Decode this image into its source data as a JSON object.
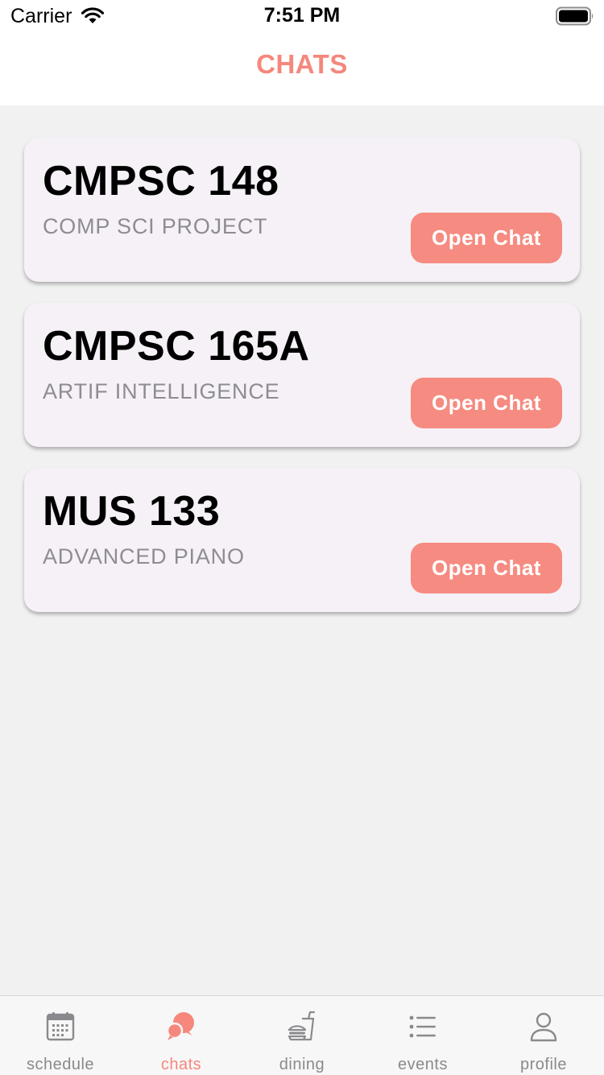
{
  "status_bar": {
    "carrier": "Carrier",
    "time": "7:51 PM"
  },
  "header": {
    "title": "CHATS"
  },
  "chats": [
    {
      "code": "CMPSC 148",
      "name": "COMP SCI PROJECT",
      "button": "Open Chat"
    },
    {
      "code": "CMPSC 165A",
      "name": "ARTIF INTELLIGENCE",
      "button": "Open Chat"
    },
    {
      "code": "MUS 133",
      "name": "ADVANCED PIANO",
      "button": "Open Chat"
    }
  ],
  "tabs": [
    {
      "label": "schedule",
      "icon": "calendar-icon"
    },
    {
      "label": "chats",
      "icon": "chat-bubbles-icon",
      "active": true
    },
    {
      "label": "dining",
      "icon": "burger-drink-icon"
    },
    {
      "label": "events",
      "icon": "list-icon"
    },
    {
      "label": "profile",
      "icon": "person-icon"
    }
  ],
  "colors": {
    "accent": "#f5877c",
    "button": "#f68b81",
    "card_background": "#f6f1f7",
    "page_background": "#f1f1f1",
    "tab_inactive": "#8a8a8e"
  }
}
